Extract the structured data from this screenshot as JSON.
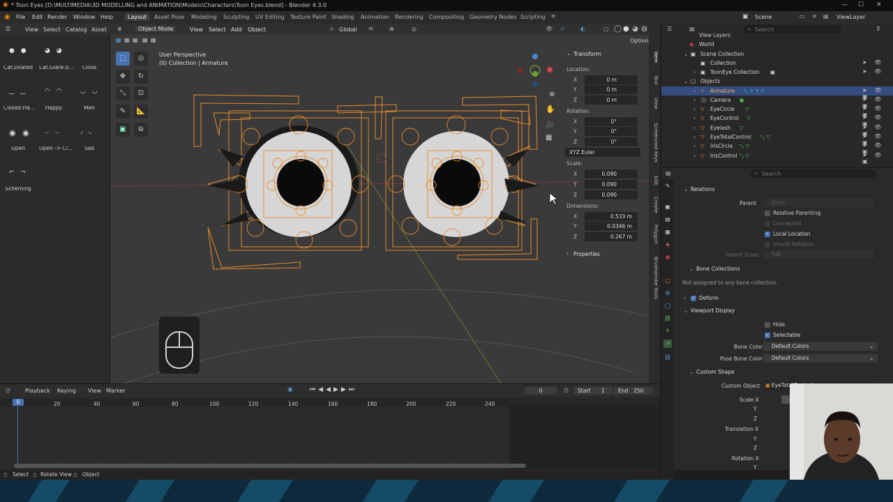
{
  "window": {
    "title": "* Toon Eyes [D:\\MULTIMEDIA\\3D MODELLING and ANIMATION\\Models\\Characters\\Toon Eyes.blend] - Blender 4.3.0"
  },
  "menu": [
    "File",
    "Edit",
    "Render",
    "Window",
    "Help"
  ],
  "workspaces": [
    "Layout",
    "Asset Pose",
    "Modeling",
    "Sculpting",
    "UV Editing",
    "Texture Paint",
    "Shading",
    "Animation",
    "Rendering",
    "Compositing",
    "Geometry Nodes",
    "Scripting"
  ],
  "scene": {
    "name": "Scene",
    "view_layer": "ViewLayer"
  },
  "pose_library": {
    "header": [
      "View",
      "Select",
      "Catalog",
      "Asset"
    ],
    "poses": [
      "Cat.Dilated",
      "Cat.Glare.0...",
      "Close",
      "Closed.Ha...",
      "Happy",
      "Meh",
      "Open",
      "Open -> Cl...",
      "Sad",
      "Scheming"
    ]
  },
  "viewport": {
    "mode": "Object Mode",
    "menus": [
      "View",
      "Select",
      "Add",
      "Object"
    ],
    "orientation": "Global",
    "options_label": "Options",
    "perspective": "User Perspective",
    "collection": "(0) Collection | Armature"
  },
  "npanel": {
    "transform_title": "Transform",
    "location_label": "Location:",
    "location": [
      "0 m",
      "0 m",
      "0 m"
    ],
    "rotation_label": "Rotation:",
    "rotation": [
      "0°",
      "0°",
      "0°"
    ],
    "rotation_mode": "XYZ Euler",
    "scale_label": "Scale:",
    "scale": [
      "0.090",
      "0.090",
      "0.090"
    ],
    "dimensions_label": "Dimensions:",
    "dimensions": [
      "0.533 m",
      "0.0346 m",
      "0.267 m"
    ],
    "properties_label": "Properties",
    "axes": [
      "X",
      "Y",
      "Z"
    ]
  },
  "vtabs": [
    "Item",
    "Tool",
    "View",
    "Screencast Keys",
    "Edit",
    "Create",
    "Polygon",
    "Brushstroke Tools"
  ],
  "outliner": {
    "search_placeholder": "Search",
    "rows": [
      "View Layers",
      "World",
      "Scene Collection",
      "Collection",
      "ToonEye Collection",
      "Objects",
      "Armature",
      "Camera",
      "EyeCircle",
      "EyeControl",
      "Eyelash",
      "EyeTotalControl",
      "IrisCircle",
      "IrisControl"
    ]
  },
  "properties": {
    "search_placeholder": "Search",
    "relations_title": "Relations",
    "parent_label": "Parent",
    "parent_value": "None",
    "relative_parenting": "Relative Parenting",
    "connected": "Connected",
    "local_location": "Local Location",
    "inherit_rotation": "Inherit Rotation",
    "inherit_scale_label": "Inherit Scale",
    "inherit_scale_value": "Full",
    "bone_collections_title": "Bone Collections",
    "bone_collections_note": "Not assigned to any bone collection.",
    "deform_title": "Deform",
    "viewport_display_title": "Viewport Display",
    "hide": "Hide",
    "selectable": "Selectable",
    "bone_color_label": "Bone Color",
    "bone_color_value": "Default Colors",
    "pose_bone_color_label": "Pose Bone Color",
    "pose_bone_color_value": "Default Colors",
    "custom_shape_title": "Custom Shape",
    "custom_object_label": "Custom Object",
    "custom_object_value": "EyeTotalControl",
    "scale_x_label": "Scale X",
    "translation_x_label": "Translation X",
    "rotation_x_label": "Rotation X",
    "y_label": "Y",
    "z_label": "Z"
  },
  "timeline": {
    "menus": [
      "Playback",
      "Keying",
      "View",
      "Marker"
    ],
    "current_frame": "0",
    "start_label": "Start",
    "start": "1",
    "end_label": "End",
    "end": "250",
    "ticks": [
      "0",
      "20",
      "40",
      "60",
      "80",
      "100",
      "120",
      "140",
      "160",
      "180",
      "200",
      "220",
      "240"
    ]
  },
  "statusbar": [
    "Select",
    "Rotate View",
    "Object"
  ]
}
